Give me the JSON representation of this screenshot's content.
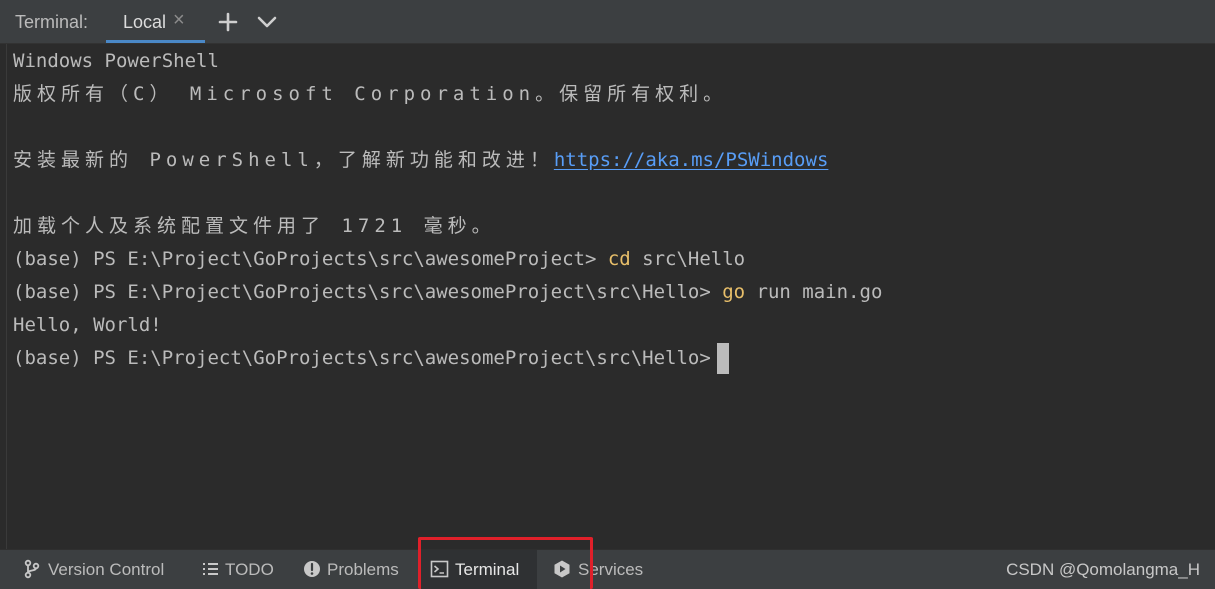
{
  "header": {
    "title": "Terminal:",
    "tab_label": "Local",
    "tab_close_icon": "close-icon",
    "new_tab_icon": "plus-icon",
    "options_icon": "chevron-down-icon",
    "accent_color": "#4a88c7"
  },
  "terminal": {
    "lines": [
      {
        "text": "Windows PowerShell"
      },
      {
        "text": "版权所有（C） Microsoft Corporation。保留所有权利。"
      },
      {
        "text": ""
      },
      {
        "prefix": "安装最新的 PowerShell，了解新功能和改进！",
        "link": "https://aka.ms/PSWindows"
      },
      {
        "text": ""
      },
      {
        "text": "加载个人及系统配置文件用了 1721 毫秒。"
      },
      {
        "prompt": "(base) PS E:\\Project\\GoProjects\\src\\awesomeProject> ",
        "command": "cd",
        "args": " src\\Hello"
      },
      {
        "prompt": "(base) PS E:\\Project\\GoProjects\\src\\awesomeProject\\src\\Hello> ",
        "command": "go",
        "args": " run main.go"
      },
      {
        "text": "Hello, World!"
      },
      {
        "prompt": "(base) PS E:\\Project\\GoProjects\\src\\awesomeProject\\src\\Hello>"
      }
    ],
    "link_color": "#589df6",
    "command_color": "#e8bf6a"
  },
  "statusbar": {
    "items": [
      {
        "label": "Version Control",
        "icon": "branch-icon"
      },
      {
        "label": "TODO",
        "icon": "list-icon"
      },
      {
        "label": "Problems",
        "icon": "warning-icon"
      },
      {
        "label": "Terminal",
        "icon": "terminal-icon",
        "active": true
      },
      {
        "label": "Services",
        "icon": "play-icon"
      }
    ],
    "watermark": "CSDN @Qomolangma_H",
    "highlight_color": "#e0202a"
  }
}
